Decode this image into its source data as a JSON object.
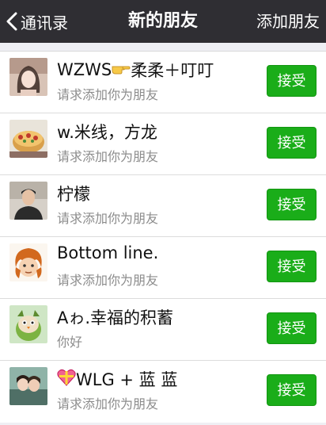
{
  "navbar": {
    "back_label": "通讯录",
    "title": "新的朋友",
    "action_label": "添加朋友"
  },
  "requests": [
    {
      "name": "WZWS",
      "name_suffix": "柔柔＋叮叮",
      "message": "请求添加你为朋友",
      "accept_label": "接受"
    },
    {
      "name": "w.米线，方龙",
      "message": "请求添加你为朋友",
      "accept_label": "接受"
    },
    {
      "name": "柠檬",
      "message": "请求添加你为朋友",
      "accept_label": "接受"
    },
    {
      "name": "Bottom line.",
      "message": "请求添加你为朋友",
      "accept_label": "接受"
    },
    {
      "name": "Aゎ.幸福的积蓄",
      "message": "你好",
      "accept_label": "接受"
    },
    {
      "name": "WLG + 蓝 蓝",
      "message": "请求添加你为朋友",
      "accept_label": "接受"
    }
  ],
  "colors": {
    "navbar": "#2f2e33",
    "accept_button": "#1aad19",
    "background": "#efeff4"
  }
}
